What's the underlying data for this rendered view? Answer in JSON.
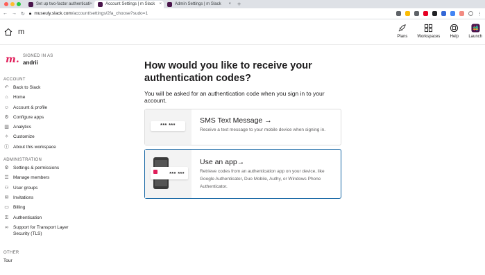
{
  "browser": {
    "tabs": [
      {
        "label": "Set up two-factor authenticati",
        "active": false
      },
      {
        "label": "Account Settings | m Slack",
        "active": true
      },
      {
        "label": "Admin Settings | m Slack",
        "active": false
      }
    ],
    "url_domain": "museuly.slack.com",
    "url_path": "/account/settings/2fa_choose?sudo=1"
  },
  "header": {
    "workspace_name": "m",
    "nav": [
      {
        "label": "Plans",
        "icon": "rocket-icon"
      },
      {
        "label": "Workspaces",
        "icon": "grid-icon"
      },
      {
        "label": "Help",
        "icon": "lifebuoy-icon"
      },
      {
        "label": "Launch",
        "icon": "slack-logo-icon"
      }
    ]
  },
  "sidebar": {
    "logo": "m.",
    "signed_in_label": "SIGNED IN AS",
    "username": "andrii",
    "account_label": "ACCOUNT",
    "account_items": [
      {
        "label": "Back to Slack",
        "icon": "back-arrow-icon"
      },
      {
        "label": "Home",
        "icon": "home-icon"
      },
      {
        "label": "Account & profile",
        "icon": "person-icon"
      },
      {
        "label": "Configure apps",
        "icon": "apps-icon"
      },
      {
        "label": "Analytics",
        "icon": "chart-icon"
      },
      {
        "label": "Customize",
        "icon": "wand-icon"
      },
      {
        "label": "About this workspace",
        "icon": "info-icon"
      }
    ],
    "admin_label": "ADMINISTRATION",
    "admin_items": [
      {
        "label": "Settings & permissions",
        "icon": "gear-icon"
      },
      {
        "label": "Manage members",
        "icon": "members-icon"
      },
      {
        "label": "User groups",
        "icon": "group-icon"
      },
      {
        "label": "Invitations",
        "icon": "envelope-icon"
      },
      {
        "label": "Billing",
        "icon": "card-icon"
      },
      {
        "label": "Authentication",
        "icon": "key-icon"
      },
      {
        "label": "Support for Transport Layer Security (TLS)",
        "icon": "link-icon"
      }
    ],
    "other_label": "OTHER",
    "other_items": [
      {
        "label": "Tour"
      }
    ]
  },
  "main": {
    "title": "How would you like to receive your authentication codes?",
    "subtitle": "You will be asked for an authentication code when you sign in to your account.",
    "options": [
      {
        "title": "SMS Text Message",
        "arrow": "→",
        "description": "Receive a text message to your mobile device when signing in.",
        "thumb_code": "*** ***",
        "selected": false
      },
      {
        "title": "Use an app",
        "arrow": "→",
        "description": "Retrieve codes from an authentication app on your device, like Google Authenticator, Duo Mobile, Authy, or Windows Phone Authenticator.",
        "thumb_code": "*** ***",
        "selected": true
      }
    ]
  },
  "colors": {
    "selected_border": "#1264a3",
    "logo": "#e01e5a",
    "muted_text": "#616061"
  }
}
